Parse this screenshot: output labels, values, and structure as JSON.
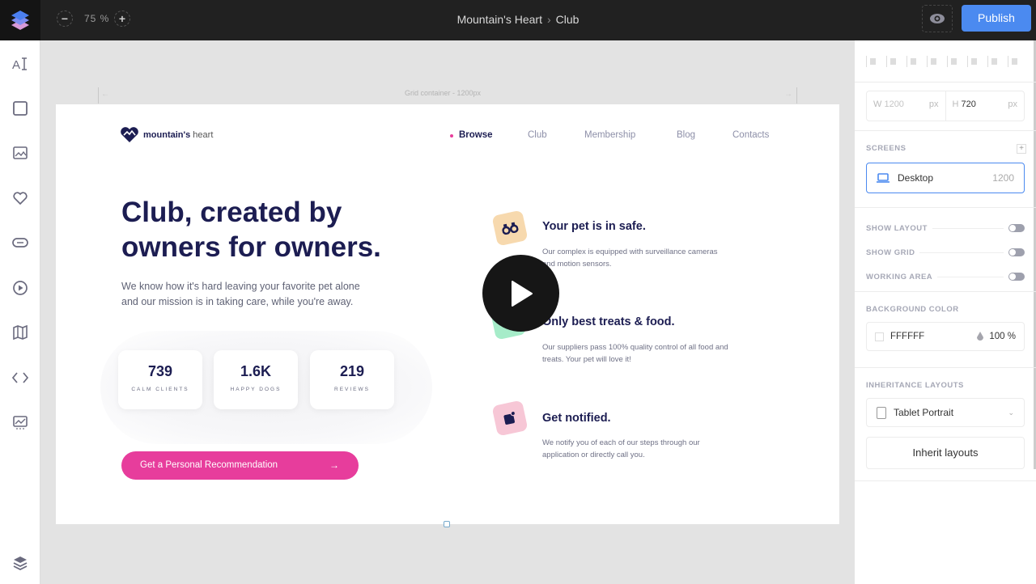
{
  "topbar": {
    "zoom_out": "−",
    "zoom_value": "75 %",
    "zoom_in": "+",
    "breadcrumb": [
      "Mountain's Heart",
      "Club"
    ],
    "breadcrumb_sep": "›",
    "publish_label": "Publish"
  },
  "leftbar": {
    "tools": [
      "text-tool-icon",
      "rectangle-tool-icon",
      "image-tool-icon",
      "heart-icon",
      "button-tool-icon",
      "video-tool-icon",
      "map-icon",
      "code-icon",
      "chart-widget-icon"
    ],
    "bottom": "layers-icon"
  },
  "canvas": {
    "grid_label": "Grid container - 1200px"
  },
  "site": {
    "brand_bold": "mountain's",
    "brand_light": "heart",
    "nav": [
      "Browse",
      "Club",
      "Membership",
      "Blog",
      "Contacts"
    ],
    "active_nav": "Browse",
    "hero_title": "Club, created by owners for owners.",
    "hero_sub": "We know how it's hard leaving your favorite pet alone and our mission is in taking care, while you're away.",
    "stats": [
      {
        "value": "739",
        "label": "CALM CLIENTS"
      },
      {
        "value": "1.6K",
        "label": "HAPPY DOGS"
      },
      {
        "value": "219",
        "label": "REVIEWS"
      }
    ],
    "cta_label": "Get a Personal Recommendation",
    "cta_arrow": "→",
    "features": [
      {
        "title": "Your pet is in safe.",
        "text": "Our complex is equipped with surveillance cameras and motion sensors.",
        "color": "#f7d9ae"
      },
      {
        "title": "Only best treats & food.",
        "text": "Our suppliers pass 100% quality control of all food and treats. Your pet will love it!",
        "color": "#a6ecc9"
      },
      {
        "title": "Get notified.",
        "text": "We notify you of each of our steps through our application or directly call you.",
        "color": "#f7c7d6"
      }
    ],
    "accent": "#e73d9c",
    "navy": "#1c1d52"
  },
  "inspector": {
    "width_label": "W",
    "width_value": "1200",
    "width_unit": "px",
    "height_label": "H",
    "height_value": "720",
    "height_unit": "px",
    "screens_title": "SCREENS",
    "screen_name": "Desktop",
    "screen_width": "1200",
    "toggles": [
      {
        "label": "SHOW LAYOUT",
        "on": false
      },
      {
        "label": "SHOW GRID",
        "on": false
      },
      {
        "label": "WORKING AREA",
        "on": false
      }
    ],
    "bg_title": "BACKGROUND COLOR",
    "bg_value": "FFFFFF",
    "bg_opacity": "100 %",
    "inherit_title": "INHERITANCE LAYOUTS",
    "inherit_select": "Tablet Portrait",
    "inherit_button": "Inherit layouts"
  }
}
